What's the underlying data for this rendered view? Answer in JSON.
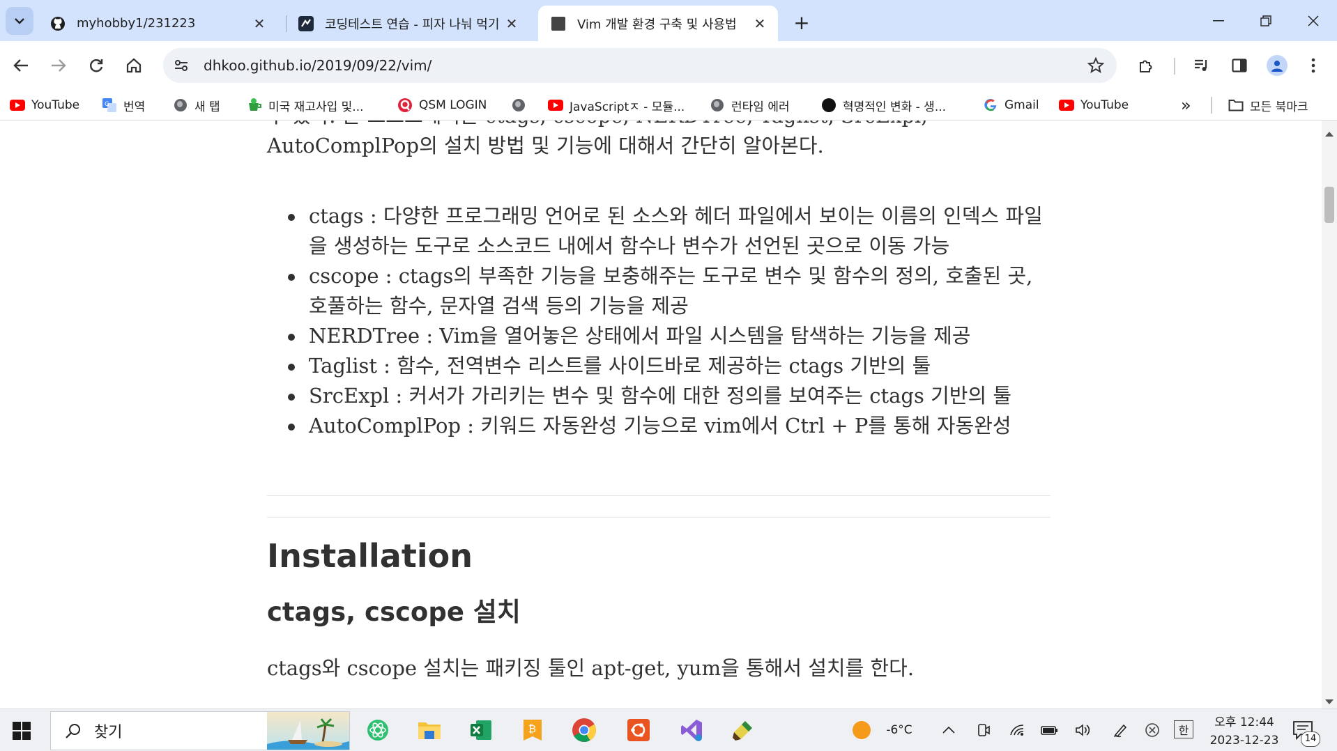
{
  "browser": {
    "tabs": [
      {
        "title": "myhobby1/231223",
        "icon": "github-icon",
        "active": false
      },
      {
        "title": "코딩테스트 연습 - 피자 나눠 먹기",
        "icon": "programmers-icon",
        "active": false
      },
      {
        "title": "Vim 개발 환경 구축 및 사용법",
        "icon": "page-icon",
        "active": true
      }
    ],
    "new_tab": "+",
    "window_controls": {
      "minimize": "minimize-icon",
      "restore": "restore-icon",
      "close": "close-icon"
    },
    "url": "dhkoo.github.io/2019/09/22/vim/"
  },
  "bookmarks": [
    {
      "label": "YouTube",
      "icon": "youtube-icon"
    },
    {
      "label": "번역",
      "icon": "translate-icon"
    },
    {
      "label": "새 탭",
      "icon": "globe-icon"
    },
    {
      "label": "미국 재고사입 및...",
      "icon": "green-cup-icon"
    },
    {
      "label": "QSM LOGIN",
      "icon": "qsm-icon"
    },
    {
      "label": "",
      "icon": "globe-icon"
    },
    {
      "label": "JavaScriptㅈ - 모듈...",
      "icon": "youtube-icon"
    },
    {
      "label": "런타임 에러",
      "icon": "globe-icon"
    },
    {
      "label": "혁명적인 변화 - 생...",
      "icon": "black-circle-icon"
    },
    {
      "label": "Gmail",
      "icon": "google-icon"
    },
    {
      "label": "YouTube",
      "icon": "youtube-icon"
    }
  ],
  "bookmarks_overflow": "»",
  "all_bookmarks": "모든 북마크",
  "article": {
    "intro_line1": "수 있다. 본 포스트에서는 ctags, cscope, NERDTree, Taglist, SrcExpl,",
    "intro_line2": "AutoComplPop의 설치 방법 및 기능에 대해서 간단히 알아본다.",
    "features": [
      "ctags : 다양한 프로그래밍 언어로 된 소스와 헤더 파일에서 보이는 이름의 인덱스 파일을 생성하는 도구로 소스코드 내에서 함수나 변수가 선언된 곳으로 이동 가능",
      "cscope : ctags의 부족한 기능을 보충해주는 도구로 변수 및 함수의 정의, 호출된 곳, 호풀하는 함수, 문자열 검색 등의 기능을 제공",
      "NERDTree : Vim을 열어놓은 상태에서 파일 시스템을 탐색하는 기능을 제공",
      "Taglist : 함수, 전역변수 리스트를 사이드바로 제공하는 ctags 기반의 툴",
      "SrcExpl : 커서가 가리키는 변수 및 함수에 대한 정의를 보여주는 ctags 기반의 툴",
      "AutoComplPop : 키워드 자동완성 기능으로 vim에서 Ctrl + P를 통해 자동완성"
    ],
    "heading_installation": "Installation",
    "heading_ctags": "ctags, cscope 설치",
    "install_text": "ctags와 cscope 설치는 패키징 툴인 apt-get, yum을 통해서 설치를 한다."
  },
  "taskbar": {
    "search_label": "찾기",
    "apps": [
      "atom-icon",
      "file-explorer-icon",
      "excel-icon",
      "bitcoin-app-icon",
      "chrome-icon",
      "ubuntu-icon",
      "visual-studio-icon",
      "paint-icon"
    ],
    "weather_temp": "-6°C",
    "ime": "한",
    "time": "오후 12:44",
    "date": "2023-12-23",
    "notifications": "14"
  }
}
